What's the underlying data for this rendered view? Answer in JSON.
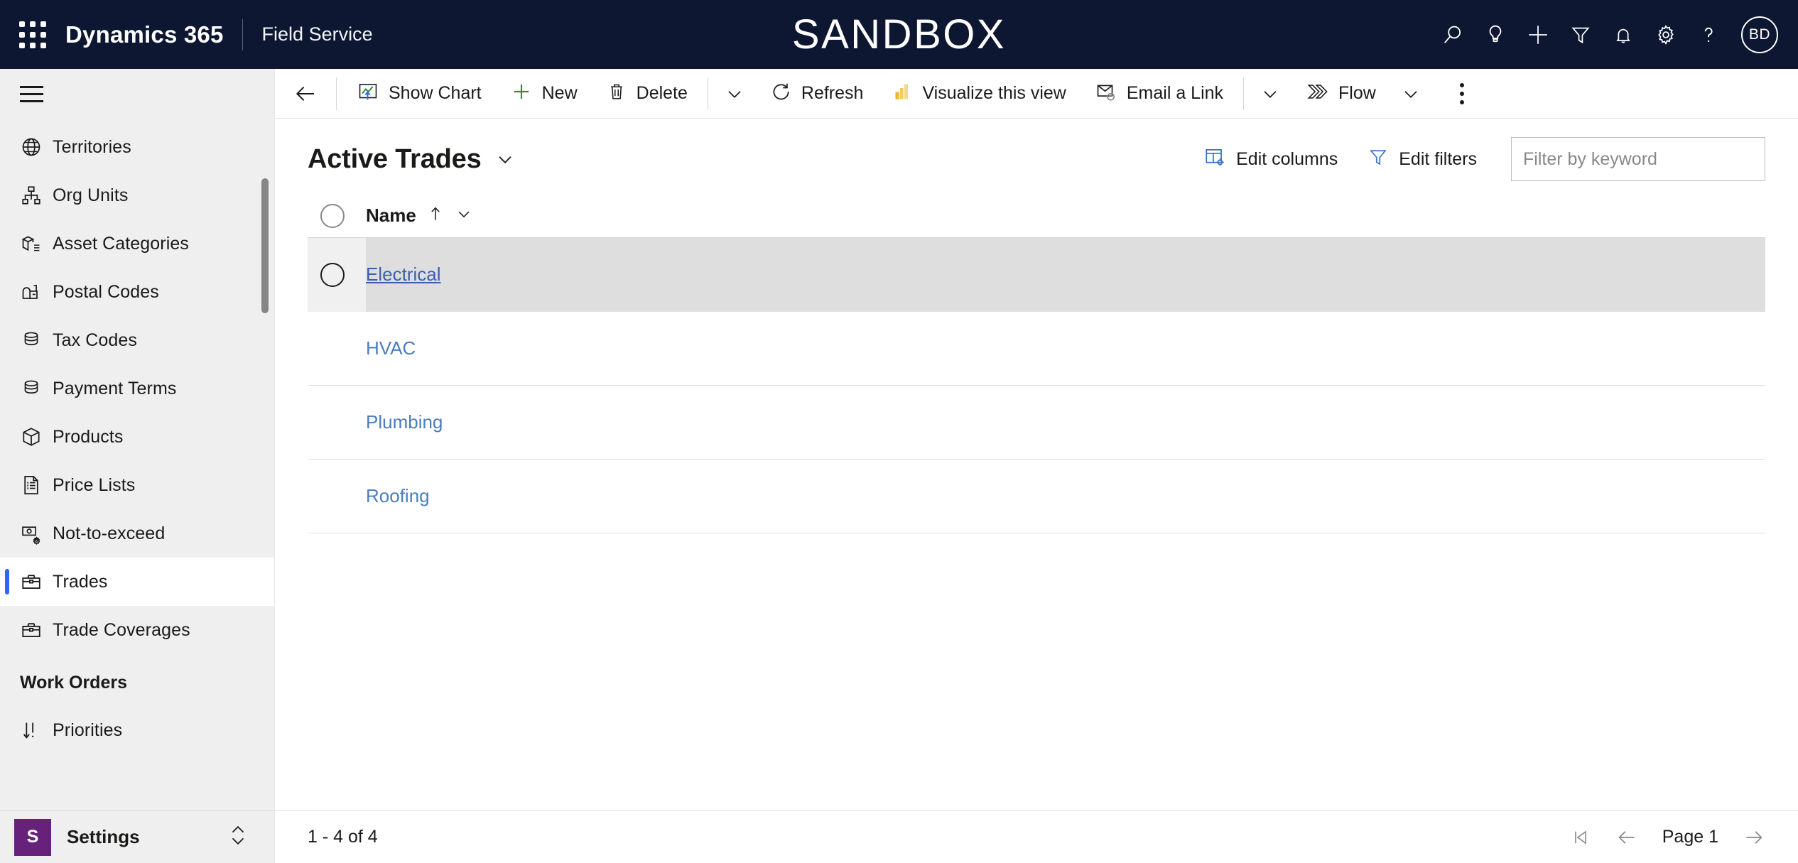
{
  "header": {
    "waffle_icon": "app-launcher-icon",
    "brand": "Dynamics 365",
    "app_name": "Field Service",
    "environment_banner": "SANDBOX",
    "icons": [
      {
        "name": "search-icon",
        "label": "Search"
      },
      {
        "name": "lightbulb-icon",
        "label": "Assistant"
      },
      {
        "name": "plus-icon",
        "label": "Quick create"
      },
      {
        "name": "filter-icon",
        "label": "Filter"
      },
      {
        "name": "bell-icon",
        "label": "Notifications"
      },
      {
        "name": "gear-icon",
        "label": "Settings"
      },
      {
        "name": "question-icon",
        "label": "Help"
      }
    ],
    "avatar_initials": "BD",
    "background_color": "#0d1731"
  },
  "sidebar": {
    "hamburger_label": "Site Map",
    "items": [
      {
        "label": "Territories",
        "icon": "globe-icon",
        "selected": false
      },
      {
        "label": "Org Units",
        "icon": "org-chart-icon",
        "selected": false
      },
      {
        "label": "Asset Categories",
        "icon": "asset-category-icon",
        "selected": false
      },
      {
        "label": "Postal Codes",
        "icon": "mailbox-icon",
        "selected": false
      },
      {
        "label": "Tax Codes",
        "icon": "coins-icon",
        "selected": false
      },
      {
        "label": "Payment Terms",
        "icon": "coins-icon",
        "selected": false
      },
      {
        "label": "Products",
        "icon": "box-icon",
        "selected": false
      },
      {
        "label": "Price Lists",
        "icon": "document-list-icon",
        "selected": false
      },
      {
        "label": "Not-to-exceed",
        "icon": "money-gear-icon",
        "selected": false
      },
      {
        "label": "Trades",
        "icon": "toolbox-icon",
        "selected": true
      },
      {
        "label": "Trade Coverages",
        "icon": "toolbox-icon",
        "selected": false
      }
    ],
    "group_title": "Work Orders",
    "group_items": [
      {
        "label": "Priorities",
        "icon": "sort-priority-icon",
        "selected": false
      }
    ],
    "footer": {
      "badge": "S",
      "badge_color": "#68217a",
      "label": "Settings",
      "chevrons_icon": "chevron-up-down-icon"
    },
    "selection_accent": "#2f66f5",
    "background_color": "#efefef"
  },
  "commandbar": {
    "back_icon": "back-arrow-icon",
    "buttons": [
      {
        "label": "Show Chart",
        "icon": "chart-icon"
      },
      {
        "label": "New",
        "icon": "plus-icon"
      },
      {
        "label": "Delete",
        "icon": "trash-icon"
      }
    ],
    "more_chevron_1": "chevron-down-icon",
    "buttons2": [
      {
        "label": "Refresh",
        "icon": "refresh-icon"
      },
      {
        "label": "Visualize this view",
        "icon": "powerbi-icon"
      },
      {
        "label": "Email a Link",
        "icon": "email-link-icon"
      }
    ],
    "more_chevron_2": "chevron-down-icon",
    "flow": {
      "label": "Flow",
      "icon": "flow-icon",
      "chevron": "chevron-down-icon"
    },
    "overflow_icon": "more-vertical-icon"
  },
  "view": {
    "title": "Active Trades",
    "title_chevron": "chevron-down-icon",
    "edit_columns": {
      "label": "Edit columns",
      "icon": "edit-columns-icon"
    },
    "edit_filters": {
      "label": "Edit filters",
      "icon": "edit-filters-icon"
    },
    "search": {
      "value": "",
      "placeholder": "Filter by keyword"
    }
  },
  "grid": {
    "select_all_icon": "select-all-circle-icon",
    "columns": [
      {
        "label": "Name",
        "sort": "ascending",
        "sort_icon": "arrow-up-icon",
        "menu_icon": "chevron-down-icon"
      }
    ],
    "rows": [
      {
        "name": "Electrical",
        "hovered": true
      },
      {
        "name": "HVAC",
        "hovered": false
      },
      {
        "name": "Plumbing",
        "hovered": false
      },
      {
        "name": "Roofing",
        "hovered": false
      }
    ],
    "link_color": "#4a7ebd",
    "hover_row_color": "#dededf"
  },
  "footer": {
    "record_count": "1 - 4 of 4",
    "first_page_icon": "first-page-icon",
    "prev_page_icon": "previous-page-icon",
    "page_label": "Page 1",
    "next_page_icon": "next-page-icon"
  }
}
